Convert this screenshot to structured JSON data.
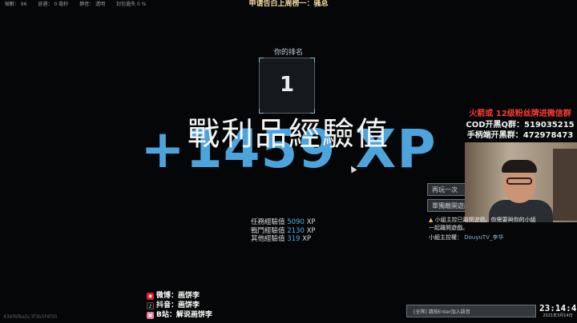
{
  "top_stats": [
    "幀數：  96",
    "延遲：  0 毫秒",
    "靜音：  透明",
    "封包遺失 0 %"
  ],
  "banner": "申请告白上周榜一：骚总",
  "rank": {
    "label": "你的排名",
    "value": "1"
  },
  "xp_title": "戰利品經驗值",
  "xp_total": "+1459 XP",
  "buttons": {
    "play_again": "再玩一次",
    "leave": "單獨離開遊戲"
  },
  "xp_breakdown": [
    {
      "label": "任務經驗值",
      "value": "5090",
      "unit": "XP"
    },
    {
      "label": "戰鬥經驗值",
      "value": "2130",
      "unit": "XP"
    },
    {
      "label": "其他經驗值",
      "value": "319",
      "unit": "XP"
    }
  ],
  "watermark": "436f6f6a5c3f3b5f4f30",
  "social": [
    {
      "icon": "weibo-icon",
      "text": "微博：画饼李"
    },
    {
      "icon": "douyin-icon",
      "text": "抖音：画饼李"
    },
    {
      "icon": "bilibili-icon",
      "text": "B站：解说画饼李"
    }
  ],
  "fan_lines": [
    {
      "prefix": "火箭或 ",
      "highlight": "12级",
      "rest": "粉丝牌进微信群"
    },
    {
      "prefix": "COD开黑Q群：",
      "highlight": "",
      "rest": "519035215"
    },
    {
      "prefix": "手柄端开黑群：",
      "highlight": "",
      "rest": "472978473"
    }
  ],
  "chat": {
    "line1": "小組主控已離開遊戲。你需要與你的小組",
    "line2": "一起離開遊戲。",
    "line3_label": "小組主控權：",
    "line3_value": "DouyuTV_李华"
  },
  "input_placeholder": "[全隊] 請按Enter加入語音",
  "clock": {
    "time": "23:14:45",
    "date": "2021年3月14日"
  },
  "colors": {
    "xp_blue": "#4da4dc",
    "banner_gold": "#f0d7a0",
    "fan_red": "#ff3b30"
  }
}
